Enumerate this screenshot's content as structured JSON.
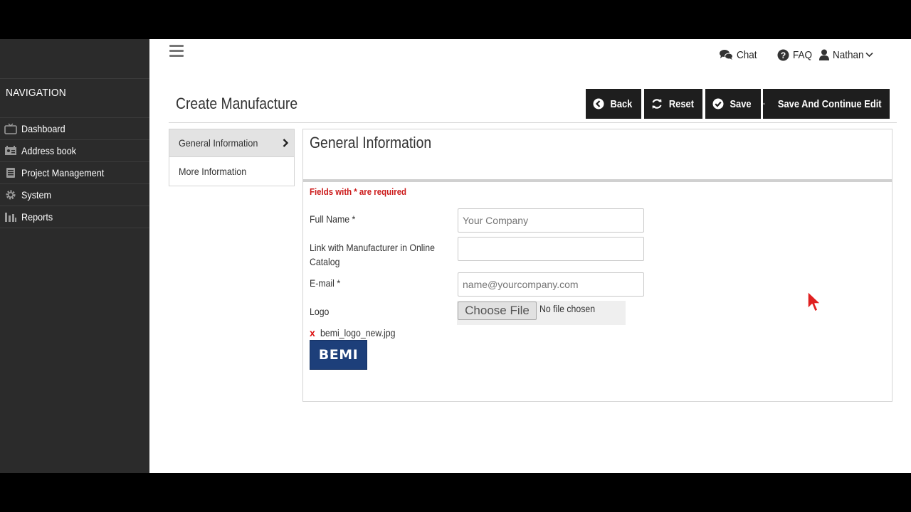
{
  "sidebar": {
    "heading": "NAVIGATION",
    "items": [
      {
        "label": "Dashboard",
        "icon": "tv-icon"
      },
      {
        "label": "Address book",
        "icon": "address-book-icon"
      },
      {
        "label": "Project Management",
        "icon": "list-icon"
      },
      {
        "label": "System",
        "icon": "gear-icon"
      },
      {
        "label": "Reports",
        "icon": "bar-chart-icon"
      }
    ]
  },
  "topnav": {
    "chat": "Chat",
    "faq": "FAQ",
    "user": "Nathan"
  },
  "page": {
    "title": "Create Manufacture"
  },
  "actions": {
    "back": "Back",
    "reset": "Reset",
    "save": "Save",
    "save_continue": "Save And Continue Edit"
  },
  "tabs": [
    {
      "label": "General Information",
      "active": true
    },
    {
      "label": "More Information",
      "active": false
    }
  ],
  "form": {
    "section_title": "General Information",
    "required_note": "Fields with * are required",
    "full_name": {
      "label": "Full Name *",
      "placeholder": "Your Company"
    },
    "catalog_link": {
      "label_line1": "Link with Manufacturer in Online",
      "label_line2": "Catalog",
      "value": ""
    },
    "email": {
      "label": "E-mail *",
      "placeholder": "name@yourcompany.com"
    },
    "logo": {
      "label": "Logo",
      "choose_button": "Choose File",
      "file_status": "No file chosen",
      "remove_mark": "x",
      "current_file": "bemi_logo_new.jpg",
      "preview_text": "BEMI"
    }
  },
  "colors": {
    "sidebar_bg": "#2b2b2b",
    "button_bg": "#1e1e1e",
    "required_red": "#cc1b1b",
    "logo_blue": "#1d3f7a"
  }
}
